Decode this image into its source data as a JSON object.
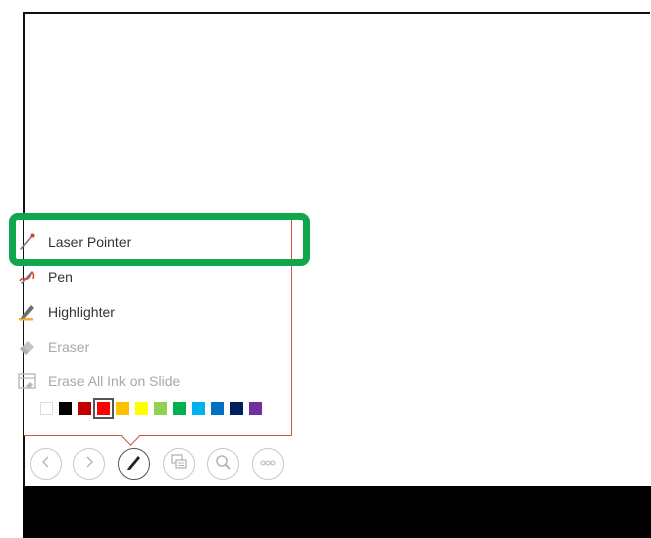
{
  "pen_menu": {
    "items": [
      {
        "label": "Laser Pointer",
        "enabled": true,
        "icon": "laser-pointer-icon"
      },
      {
        "label": "Pen",
        "enabled": true,
        "icon": "pen-icon"
      },
      {
        "label": "Highlighter",
        "enabled": true,
        "icon": "highlighter-icon"
      },
      {
        "label": "Eraser",
        "enabled": false,
        "icon": "eraser-icon"
      },
      {
        "label": "Erase All Ink on Slide",
        "enabled": false,
        "icon": "erase-all-icon"
      }
    ],
    "colors": [
      "#ffffff",
      "#000000",
      "#c00000",
      "#ff0000",
      "#ffc000",
      "#ffff00",
      "#92d050",
      "#00b050",
      "#00b0f0",
      "#0070c0",
      "#002060",
      "#7030a0"
    ],
    "selected_color": "#ff0000"
  },
  "toolbar": {
    "buttons": [
      {
        "name": "previous-slide",
        "icon": "chevron-left-icon"
      },
      {
        "name": "next-slide",
        "icon": "chevron-right-icon"
      },
      {
        "name": "pen-tools",
        "icon": "pen-icon",
        "active": true
      },
      {
        "name": "see-all-slides",
        "icon": "slides-grid-icon"
      },
      {
        "name": "zoom",
        "icon": "magnifier-icon"
      },
      {
        "name": "more-options",
        "icon": "ellipsis-icon"
      }
    ]
  },
  "theme": {
    "highlight_color": "#10a64b",
    "menu_border_color": "#c8583a"
  }
}
